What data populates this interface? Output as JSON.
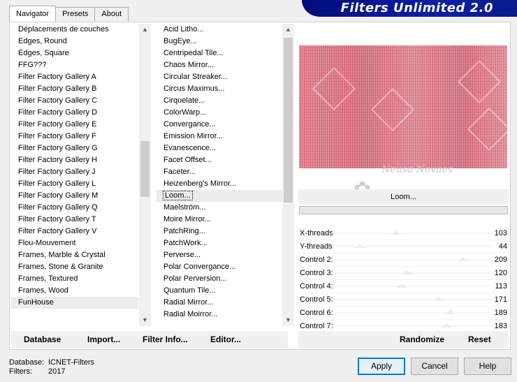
{
  "tabs": [
    "Navigator",
    "Presets",
    "About"
  ],
  "banner_title": "Filters Unlimited 2.0",
  "categories": [
    "Déplacements de couches",
    "Edges, Round",
    "Edges, Square",
    "FFG???",
    "Filter Factory Gallery A",
    "Filter Factory Gallery B",
    "Filter Factory Gallery C",
    "Filter Factory Gallery D",
    "Filter Factory Gallery E",
    "Filter Factory Gallery F",
    "Filter Factory Gallery G",
    "Filter Factory Gallery H",
    "Filter Factory Gallery J",
    "Filter Factory Gallery L",
    "Filter Factory Gallery M",
    "Filter Factory Gallery Q",
    "Filter Factory Gallery T",
    "Filter Factory Gallery V",
    "Flou-Mouvement",
    "Frames, Marble & Crystal",
    "Frames, Stone & Granite",
    "Frames, Textured",
    "Frames, Wood",
    "FunHouse"
  ],
  "selected_category": "FunHouse",
  "filters": [
    "Acid Litho...",
    "BugEye...",
    "Centripedal Tile...",
    "Chaos Mirror...",
    "Circular Streaker...",
    "Circus Maximus...",
    "Cirquelate...",
    "ColorWarp...",
    "Convergance...",
    "Emission Mirror...",
    "Evanescence...",
    "Facet Offset...",
    "Faceter...",
    "Heizenberg's Mirror...",
    "Loom...",
    "Maelström...",
    "Moire Mirror...",
    "PatchRing...",
    "PatchWork...",
    "Perverse...",
    "Polar Convergance...",
    "Polar Perversion...",
    "Quantum Tile...",
    "Radial Mirror...",
    "Radial Moirror..."
  ],
  "selected_filter": "Loom...",
  "preview_filter_name": "Loom...",
  "watermark_text": "Neusa Novaes",
  "params": [
    {
      "label": "X-threads",
      "value": "103",
      "num": 103
    },
    {
      "label": "Y-threads",
      "value": "44",
      "num": 44
    },
    {
      "label": "Control 2:",
      "value": "209",
      "num": 209
    },
    {
      "label": "Control 3:",
      "value": "120",
      "num": 120
    },
    {
      "label": "Control 4:",
      "value": "113",
      "num": 113
    },
    {
      "label": "Control 5:",
      "value": "171",
      "num": 171
    },
    {
      "label": "Control 6:",
      "value": "189",
      "num": 189
    },
    {
      "label": "Control 7:",
      "value": "183",
      "num": 183
    }
  ],
  "bottom_buttons": {
    "database": "Database",
    "import": "Import...",
    "filter_info": "Filter Info...",
    "editor": "Editor...",
    "randomize": "Randomize",
    "reset": "Reset"
  },
  "status": {
    "database_label": "Database:",
    "database_value": "ICNET-Filters",
    "filters_label": "Filters:",
    "filters_value": "2017"
  },
  "dialog_buttons": {
    "apply": "Apply",
    "cancel": "Cancel",
    "help": "Help"
  },
  "colors": {
    "banner": "#0a1fa8",
    "preview_base": "#e07a86",
    "accent": "#0078d7"
  }
}
